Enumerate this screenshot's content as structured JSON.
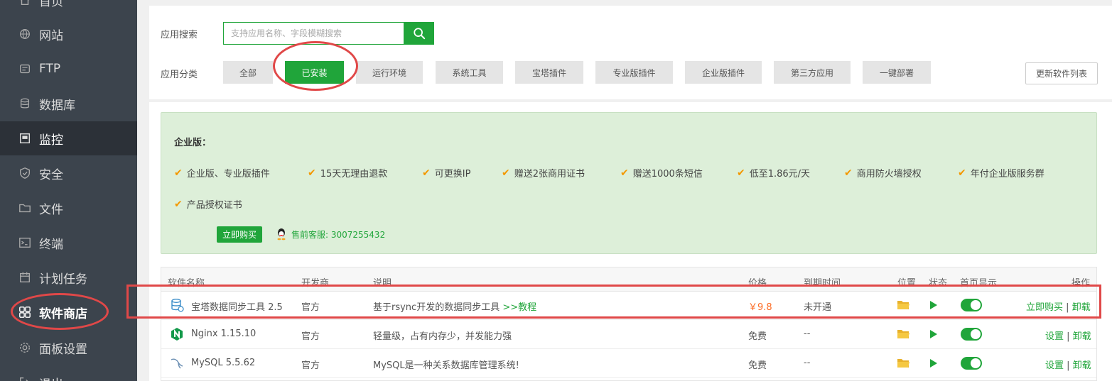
{
  "sidebar": {
    "items": [
      {
        "label": "首页",
        "icon": "home-icon"
      },
      {
        "label": "网站",
        "icon": "globe-icon"
      },
      {
        "label": "FTP",
        "icon": "ftp-icon"
      },
      {
        "label": "数据库",
        "icon": "database-icon"
      },
      {
        "label": "监控",
        "icon": "monitor-icon"
      },
      {
        "label": "安全",
        "icon": "shield-icon"
      },
      {
        "label": "文件",
        "icon": "folder-icon"
      },
      {
        "label": "终端",
        "icon": "terminal-icon"
      },
      {
        "label": "计划任务",
        "icon": "calendar-icon"
      },
      {
        "label": "软件商店",
        "icon": "grid-icon"
      },
      {
        "label": "面板设置",
        "icon": "gear-icon"
      },
      {
        "label": "退出",
        "icon": "logout-icon"
      }
    ]
  },
  "search": {
    "label": "应用搜索",
    "placeholder": "支持应用名称、字段模糊搜索"
  },
  "categories": {
    "label": "应用分类",
    "items": [
      "全部",
      "已安装",
      "运行环境",
      "系统工具",
      "宝塔插件",
      "专业版插件",
      "企业版插件",
      "第三方应用",
      "一键部署"
    ],
    "active": "已安装"
  },
  "refresh_label": "更新软件列表",
  "enterprise": {
    "title": "企业版：",
    "features": [
      "企业版、专业版插件",
      "15天无理由退款",
      "可更换IP",
      "赠送2张商用证书",
      "赠送1000条短信",
      "低至1.86元/天",
      "商用防火墙授权",
      "年付企业版服务群",
      "产品授权证书"
    ],
    "buy_label": "立即购买",
    "support": "售前客服: 3007255432"
  },
  "table": {
    "headers": {
      "name": "软件名称",
      "developer": "开发商",
      "description": "说明",
      "price": "价格",
      "expire": "到期时间",
      "location": "位置",
      "status": "状态",
      "homepage": "首页显示",
      "actions": "操作"
    },
    "rows": [
      {
        "name": "宝塔数据同步工具 2.5",
        "icon": "sync-db-icon",
        "developer": "官方",
        "description": "基于rsync开发的数据同步工具",
        "tutorial": ">>教程",
        "price": "￥9.8",
        "expire": "未开通",
        "action1": "立即购买",
        "action2": "卸载"
      },
      {
        "name": "Nginx 1.15.10",
        "icon": "nginx-icon",
        "developer": "官方",
        "description": "轻量级，占有内存少，并发能力强",
        "tutorial": "",
        "price": "免费",
        "expire": "--",
        "action1": "设置",
        "action2": "卸载"
      },
      {
        "name": "MySQL 5.5.62",
        "icon": "mysql-icon",
        "developer": "官方",
        "description": "MySQL是一种关系数据库管理系统!",
        "tutorial": "",
        "price": "免费",
        "expire": "--",
        "action1": "设置",
        "action2": "卸载"
      }
    ],
    "separator": "|"
  },
  "colors": {
    "accent": "#20a53a",
    "sidebar": "#3c444d",
    "annotation": "#e04848",
    "price": "#fc6d26"
  }
}
